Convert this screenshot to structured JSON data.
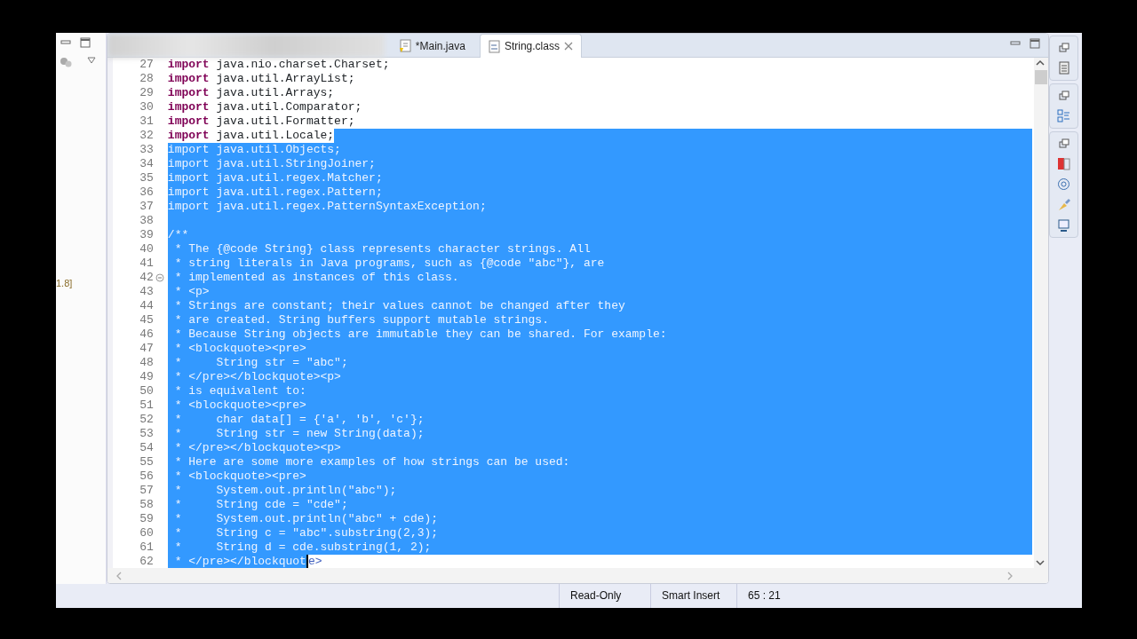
{
  "left_panel": {
    "label": "1.8]"
  },
  "tabs": [
    {
      "label": "*Main.java",
      "kind": "java",
      "selected": false,
      "closable": false
    },
    {
      "label": "String.class",
      "kind": "class",
      "selected": true,
      "closable": true
    }
  ],
  "editor": {
    "lines": [
      {
        "number": "27",
        "kind": "import",
        "parts": [
          {
            "text": "import java.nio.charset.Charset;",
            "selected": false
          }
        ],
        "eol_selected": false
      },
      {
        "number": "28",
        "kind": "import",
        "parts": [
          {
            "text": "import java.util.ArrayList;",
            "selected": false
          }
        ],
        "eol_selected": false
      },
      {
        "number": "29",
        "kind": "import",
        "parts": [
          {
            "text": "import java.util.Arrays;",
            "selected": false
          }
        ],
        "eol_selected": false
      },
      {
        "number": "30",
        "kind": "import",
        "parts": [
          {
            "text": "import java.util.Comparator;",
            "selected": false
          }
        ],
        "eol_selected": false
      },
      {
        "number": "31",
        "kind": "import",
        "parts": [
          {
            "text": "import java.util.Formatter;",
            "selected": false
          }
        ],
        "eol_selected": false
      },
      {
        "number": "32",
        "kind": "import",
        "parts": [
          {
            "text": "import java.util.Locale;",
            "selected": false
          }
        ],
        "eol_selected": true
      },
      {
        "number": "33",
        "kind": "import",
        "parts": [
          {
            "text": "import java.util.Objects;",
            "selected": true
          }
        ],
        "eol_selected": true
      },
      {
        "number": "34",
        "kind": "import",
        "parts": [
          {
            "text": "import java.util.StringJoiner;",
            "selected": true
          }
        ],
        "eol_selected": true
      },
      {
        "number": "35",
        "kind": "import",
        "parts": [
          {
            "text": "import java.util.regex.Matcher;",
            "selected": true
          }
        ],
        "eol_selected": true
      },
      {
        "number": "36",
        "kind": "import",
        "parts": [
          {
            "text": "import java.util.regex.Pattern;",
            "selected": true
          }
        ],
        "eol_selected": true
      },
      {
        "number": "37",
        "kind": "import",
        "parts": [
          {
            "text": "import java.util.regex.PatternSyntaxException;",
            "selected": true
          }
        ],
        "eol_selected": true
      },
      {
        "number": "38",
        "kind": "blank",
        "eol_selected": true
      },
      {
        "number": "39",
        "kind": "comment",
        "parts": [
          {
            "text": "/**",
            "selected": true
          }
        ],
        "eol_selected": true
      },
      {
        "number": "40",
        "kind": "comment",
        "parts": [
          {
            "text": " * The {@code String} class represents character strings. All",
            "selected": true
          }
        ],
        "eol_selected": true
      },
      {
        "number": "41",
        "kind": "comment",
        "parts": [
          {
            "text": " * string literals in Java programs, such as {@code \"abc\"}, are",
            "selected": true
          }
        ],
        "eol_selected": true
      },
      {
        "number": "42",
        "kind": "comment",
        "folded": false,
        "parts": [
          {
            "text": " * implemented as instances of this class.",
            "selected": true
          }
        ],
        "eol_selected": true
      },
      {
        "number": "43",
        "kind": "comment",
        "parts": [
          {
            "text": " * <p>",
            "selected": true
          }
        ],
        "eol_selected": true
      },
      {
        "number": "44",
        "kind": "comment",
        "parts": [
          {
            "text": " * Strings are constant; their values cannot be changed after they",
            "selected": true
          }
        ],
        "eol_selected": true
      },
      {
        "number": "45",
        "kind": "comment",
        "parts": [
          {
            "text": " * are created. String buffers support mutable strings.",
            "selected": true
          }
        ],
        "eol_selected": true
      },
      {
        "number": "46",
        "kind": "comment",
        "parts": [
          {
            "text": " * Because String objects are immutable they can be shared. For example:",
            "selected": true
          }
        ],
        "eol_selected": true
      },
      {
        "number": "47",
        "kind": "comment",
        "parts": [
          {
            "text": " * <blockquote><pre>",
            "selected": true
          }
        ],
        "eol_selected": true
      },
      {
        "number": "48",
        "kind": "comment",
        "parts": [
          {
            "text": " *     String str = \"abc\";",
            "selected": true
          }
        ],
        "eol_selected": true
      },
      {
        "number": "49",
        "kind": "comment",
        "parts": [
          {
            "text": " * </pre></blockquote><p>",
            "selected": true
          }
        ],
        "eol_selected": true
      },
      {
        "number": "50",
        "kind": "comment",
        "parts": [
          {
            "text": " * is equivalent to:",
            "selected": true
          }
        ],
        "eol_selected": true
      },
      {
        "number": "51",
        "kind": "comment",
        "parts": [
          {
            "text": " * <blockquote><pre>",
            "selected": true
          }
        ],
        "eol_selected": true
      },
      {
        "number": "52",
        "kind": "comment",
        "parts": [
          {
            "text": " *     char data[] = {'a', 'b', 'c'};",
            "selected": true
          }
        ],
        "eol_selected": true
      },
      {
        "number": "53",
        "kind": "comment",
        "parts": [
          {
            "text": " *     String str = new String(data);",
            "selected": true
          }
        ],
        "eol_selected": true
      },
      {
        "number": "54",
        "kind": "comment",
        "parts": [
          {
            "text": " * </pre></blockquote><p>",
            "selected": true
          }
        ],
        "eol_selected": true
      },
      {
        "number": "55",
        "kind": "comment",
        "parts": [
          {
            "text": " * Here are some more examples of how strings can be used:",
            "selected": true
          }
        ],
        "eol_selected": true
      },
      {
        "number": "56",
        "kind": "comment",
        "parts": [
          {
            "text": " * <blockquote><pre>",
            "selected": true
          }
        ],
        "eol_selected": true
      },
      {
        "number": "57",
        "kind": "comment",
        "parts": [
          {
            "text": " *     System.out.println(\"abc\");",
            "selected": true
          }
        ],
        "eol_selected": true
      },
      {
        "number": "58",
        "kind": "comment",
        "parts": [
          {
            "text": " *     String cde = \"cde\";",
            "selected": true
          }
        ],
        "eol_selected": true
      },
      {
        "number": "59",
        "kind": "comment",
        "parts": [
          {
            "text": " *     System.out.println(\"abc\" + cde);",
            "selected": true
          }
        ],
        "eol_selected": true
      },
      {
        "number": "60",
        "kind": "comment",
        "parts": [
          {
            "text": " *     String c = \"abc\".substring(2,3);",
            "selected": true
          }
        ],
        "eol_selected": true
      },
      {
        "number": "61",
        "kind": "comment",
        "parts": [
          {
            "text": " *     String d = cde.substring(1, 2);",
            "selected": true
          }
        ],
        "eol_selected": true
      },
      {
        "number": "62",
        "kind": "comment",
        "caret": true,
        "parts": [
          {
            "text": " * </pre></blockquot",
            "selected": true
          },
          {
            "text": "e>",
            "selected": false
          }
        ],
        "eol_selected": false
      }
    ]
  },
  "status_bar": [
    "Read-Only",
    "Smart Insert",
    "65 : 21"
  ]
}
